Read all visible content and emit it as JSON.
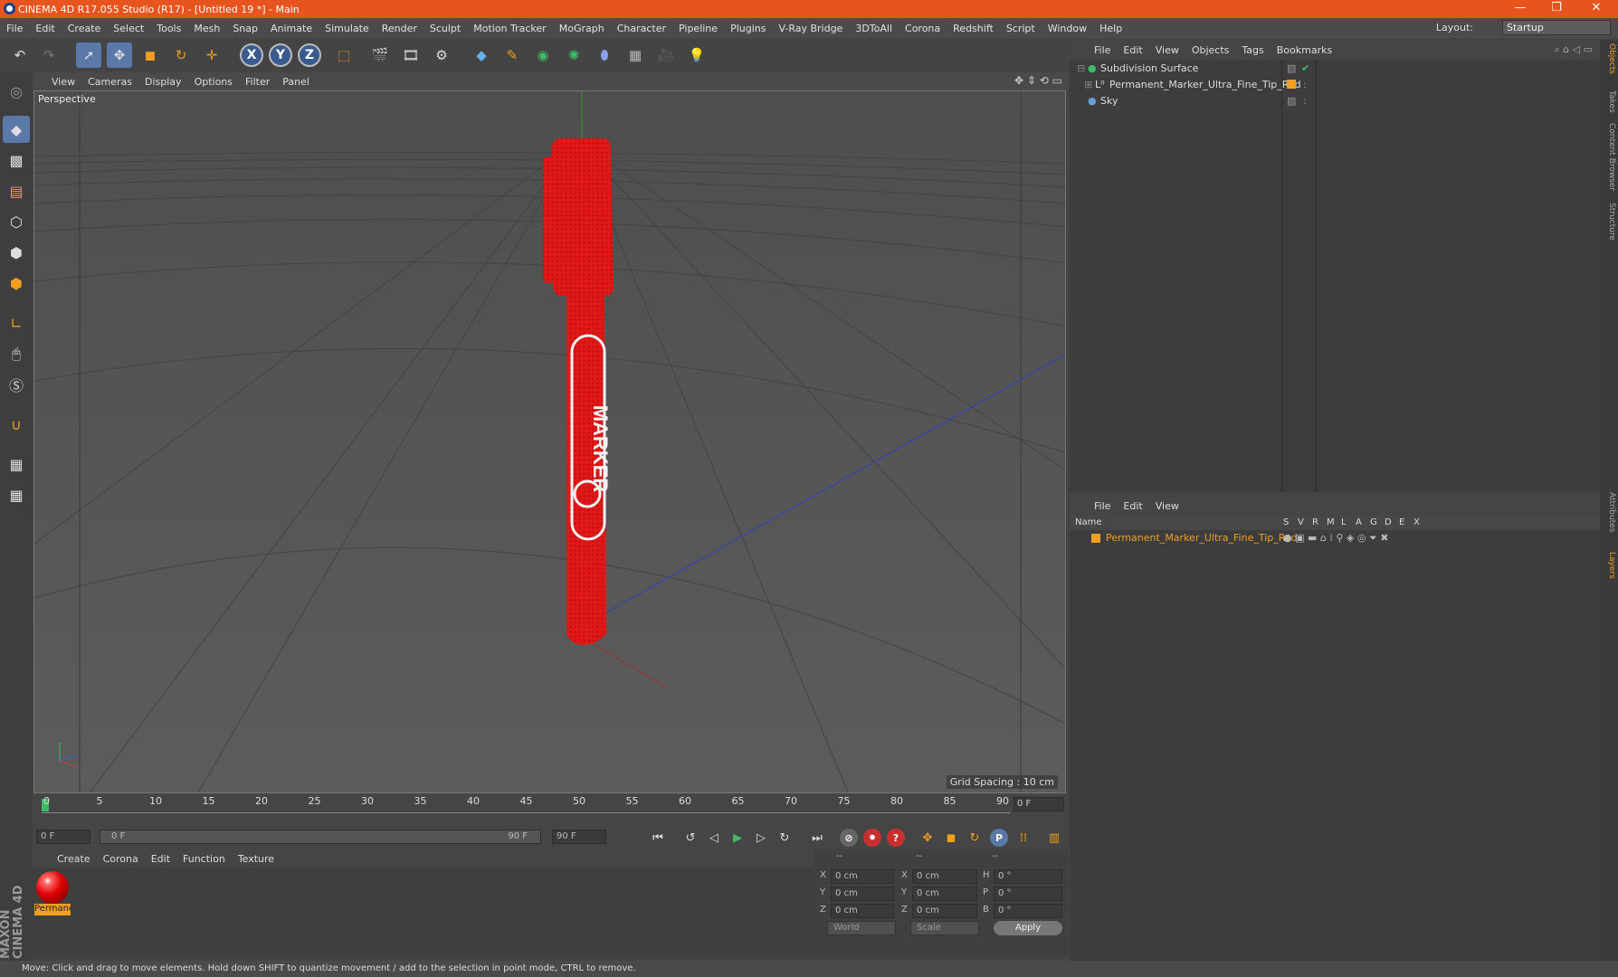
{
  "title": "CINEMA 4D R17.055 Studio (R17) - [Untitled 19 *] - Main",
  "window_buttons": [
    "—",
    "❐",
    "✕"
  ],
  "menu": [
    "File",
    "Edit",
    "Create",
    "Select",
    "Tools",
    "Mesh",
    "Snap",
    "Animate",
    "Simulate",
    "Render",
    "Sculpt",
    "Motion Tracker",
    "MoGraph",
    "Character",
    "Pipeline",
    "Plugins",
    "V-Ray Bridge",
    "3DToAll",
    "Corona",
    "Redshift",
    "Script",
    "Window",
    "Help"
  ],
  "layout_label": "Layout:",
  "layout_value": "Startup",
  "axis_buttons": [
    "X",
    "Y",
    "Z"
  ],
  "viewport_menu": [
    "View",
    "Cameras",
    "Display",
    "Options",
    "Filter",
    "Panel"
  ],
  "viewport_name": "Perspective",
  "grid_spacing": "Grid Spacing : 10 cm",
  "marker_text": "MARKER",
  "timeline_ticks": [
    "0",
    "5",
    "10",
    "15",
    "20",
    "25",
    "30",
    "35",
    "40",
    "45",
    "50",
    "55",
    "60",
    "65",
    "70",
    "75",
    "80",
    "85",
    "90"
  ],
  "timeline_frame": "0 F",
  "transport": {
    "start": "0 F",
    "slider_start": "0 F",
    "slider_end": "90 F",
    "end": "90 F"
  },
  "material_menu": [
    "Create",
    "Corona",
    "Edit",
    "Function",
    "Texture"
  ],
  "material_name": "Permanent",
  "coords": {
    "headers": [
      "--",
      "--",
      "--"
    ],
    "rows": [
      [
        "X",
        "0 cm",
        "X",
        "0 cm",
        "H",
        "0 °"
      ],
      [
        "Y",
        "0 cm",
        "Y",
        "0 cm",
        "P",
        "0 °"
      ],
      [
        "Z",
        "0 cm",
        "Z",
        "0 cm",
        "B",
        "0 °"
      ]
    ],
    "world": "World",
    "scale": "Scale",
    "apply": "Apply"
  },
  "maxon": "MAXON CINEMA 4D",
  "status": "Move: Click and drag to move elements. Hold down SHIFT to quantize movement / add to the selection in point mode, CTRL to remove.",
  "objects_menu": [
    "File",
    "Edit",
    "View",
    "Objects",
    "Tags",
    "Bookmarks"
  ],
  "objects": [
    {
      "name": "Subdivision Surface",
      "color": "#3cbc64"
    },
    {
      "name": "Permanent_Marker_Ultra_Fine_Tip_Red",
      "color": "#d8d8d8"
    },
    {
      "name": "Sky",
      "color": "#6aa0d8"
    }
  ],
  "layers_menu": [
    "File",
    "Edit",
    "View"
  ],
  "layers_header": {
    "name": "Name",
    "cols": [
      "S",
      "V",
      "R",
      "M",
      "L",
      "A",
      "G",
      "D",
      "E",
      "X"
    ]
  },
  "layer_row": "Permanent_Marker_Ultra_Fine_Tip_Red",
  "side_tabs": [
    "Objects",
    "Takes",
    "Content Browser",
    "Structure",
    "Attributes",
    "Layers"
  ],
  "accent": "#e8541d"
}
